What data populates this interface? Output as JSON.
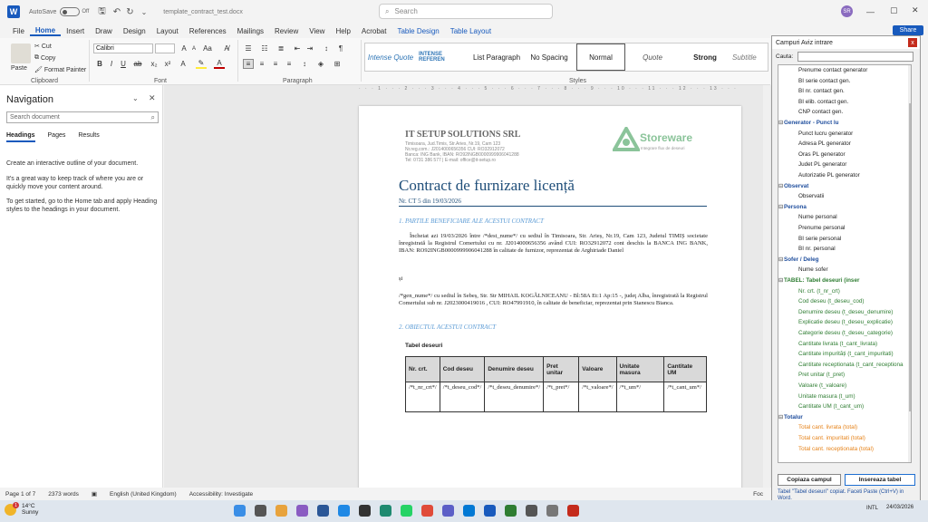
{
  "titlebar": {
    "autosave_label": "AutoSave",
    "autosave_state": "Off",
    "filename": "template_contract_test.docx",
    "search_placeholder": "Search",
    "avatar_initials": "SR",
    "share_label": "Share"
  },
  "menu": [
    "File",
    "Home",
    "Insert",
    "Draw",
    "Design",
    "Layout",
    "References",
    "Mailings",
    "Review",
    "View",
    "Help",
    "Acrobat",
    "Table Design",
    "Table Layout"
  ],
  "ribbon": {
    "clipboard": {
      "paste": "Paste",
      "cut": "Cut",
      "copy": "Copy",
      "format_painter": "Format Painter",
      "group": "Clipboard"
    },
    "font": {
      "name": "Calibri",
      "size": "",
      "group": "Font"
    },
    "paragraph": {
      "group": "Paragraph"
    },
    "styles": {
      "items": [
        "Intense Quote",
        "INTENSE REFEREN",
        "List Paragraph",
        "No Spacing",
        "Normal",
        "Quote",
        "Strong",
        "Subtitle"
      ],
      "group": "Styles"
    }
  },
  "navigation": {
    "title": "Navigation",
    "search_placeholder": "Search document",
    "tabs": [
      "Headings",
      "Pages",
      "Results"
    ],
    "p1": "Create an interactive outline of your document.",
    "p2": "It's a great way to keep track of where you are or quickly move your content around.",
    "p3": "To get started, go to the Home tab and apply Heading styles to the headings in your document."
  },
  "document": {
    "company": "IT SETUP SOLUTIONS SRL",
    "company_lines": [
      "Timisoara, Jud.Timis, Str.Aries, Nr.19, Cam 123",
      "Nr.reg.com.: J2014000656356  CUI: RO32912072",
      "Banca: ING Bank,  IBAN: RO92INGB0000999906041288",
      "Tel: 0731 386 577 | E-mail: office@it-setup.ro"
    ],
    "logo_name": "Storeware",
    "logo_tagline": "Integrare flux de deseuri",
    "title": "Contract de furnizare licență",
    "number": "Nr.  CT 5  din 19/03/2026",
    "section1": "1. PARTILE BENEFICIARE ALE ACESTUI CONTRACT",
    "para1": "Încheiat azi 19/03/2026 între /*dest_nume*/ cu sediul în Timisoara, Str. Arieș, Nr.19, Cam 123, Judetul TIMIȘ societate înregistrată la Registrul Comertului cu nr. J2014000656356 având CUI: RO32912072 cont deschis la BANCA ING BANK, IBAN: RO92INGB0000999906041288 în calitate de furnizor, reprezentat de Arghiriade Daniel",
    "si": "și",
    "para2": "/*gen_nume*/ cu sediul în Sebeș, Str. Str MIHAIL KOGĂLNICEANU - Bl:58A Et:1 Ap:15 -, judeţ Alba, înregistrată la Registrul Comertului sub nr. J2023000419016 , CUI: RO47991910, în calitate de beneficiar, reprezentat prin Stanescu Bianca.",
    "section2": "2. OBIECTUL ACESTUI CONTRACT",
    "table_label": "Tabel deseuri",
    "table_headers": [
      "Nr. crt.",
      "Cod deseu",
      "Denumire deseu",
      "Pret unitar",
      "Valoare",
      "Unitate masura",
      "Cantitate UM"
    ],
    "table_row": [
      "/*t_nr_crt*/",
      "/*t_deseu_cod*/",
      "/*t_deseu_denumire*/",
      "/*t_pret*/",
      "/*t_valoare*/",
      "/*t_um*/",
      "/*t_cant_um*/"
    ]
  },
  "sidepanel": {
    "title": "Campuri Aviz intrare",
    "search_label": "Cauta:",
    "tree": [
      {
        "text": "Prenume contact generator",
        "kind": "item"
      },
      {
        "text": "BI serie contact gen.",
        "kind": "item"
      },
      {
        "text": "BI nr. contact gen.",
        "kind": "item"
      },
      {
        "text": "BI elib. contact gen.",
        "kind": "item"
      },
      {
        "text": "CNP contact gen.",
        "kind": "item"
      },
      {
        "text": "Generator - Punct lu",
        "kind": "grp"
      },
      {
        "text": "Punct lucru generator",
        "kind": "item"
      },
      {
        "text": "Adresa PL generator",
        "kind": "item"
      },
      {
        "text": "Oras PL generator",
        "kind": "item"
      },
      {
        "text": "Judet PL generator",
        "kind": "item"
      },
      {
        "text": "Autorizatie PL generator",
        "kind": "item"
      },
      {
        "text": "Observat",
        "kind": "grp"
      },
      {
        "text": "Observatii",
        "kind": "item"
      },
      {
        "text": "Persona",
        "kind": "grp"
      },
      {
        "text": "Nume personal",
        "kind": "item"
      },
      {
        "text": "Prenume personal",
        "kind": "item"
      },
      {
        "text": "BI serie personal",
        "kind": "item"
      },
      {
        "text": "BI nr. personal",
        "kind": "item"
      },
      {
        "text": "Sofer / Deleg",
        "kind": "grp"
      },
      {
        "text": "Nume sofer",
        "kind": "item"
      },
      {
        "text": "TABEL: Tabel deseuri (inser",
        "kind": "grp-green"
      },
      {
        "text": "Nr. crt.  (t_nr_crt)",
        "kind": "green"
      },
      {
        "text": "Cod deseu  (t_deseu_cod)",
        "kind": "green"
      },
      {
        "text": "Denumire deseu  (t_deseu_denumire)",
        "kind": "green"
      },
      {
        "text": "Explicatie deseu  (t_deseu_explicatie)",
        "kind": "green"
      },
      {
        "text": "Categorie deseu  (t_deseu_categorie)",
        "kind": "green"
      },
      {
        "text": "Cantitate livrata  (t_cant_livrata)",
        "kind": "green"
      },
      {
        "text": "Cantitate impurități  (t_cant_impuritati)",
        "kind": "green"
      },
      {
        "text": "Cantitate receptionata  (t_cant_receptiona",
        "kind": "green"
      },
      {
        "text": "Pret unitar  (t_pret)",
        "kind": "green"
      },
      {
        "text": "Valoare  (t_valoare)",
        "kind": "green"
      },
      {
        "text": "Unitate masura  (t_um)",
        "kind": "green"
      },
      {
        "text": "Cantitate UM  (t_cant_um)",
        "kind": "green"
      },
      {
        "text": "Totalur",
        "kind": "grp"
      },
      {
        "text": "Total cant. livrata (total)",
        "kind": "gold"
      },
      {
        "text": "Total cant. impuritati (total)",
        "kind": "gold"
      },
      {
        "text": "Total cant. receptionata (total)",
        "kind": "gold"
      }
    ],
    "copy_button": "Copiaza campul",
    "insert_button": "Insereaza tabel",
    "message": "Tabel \"Tabel deseuri\" copiat. Faceti Paste (Ctrl+V) in Word."
  },
  "statusbar": {
    "page": "Page 1 of 7",
    "words": "2373 words",
    "language": "English (United Kingdom)",
    "accessibility": "Accessibility: Investigate",
    "focus": "Foc"
  },
  "taskbar": {
    "temp": "14°C",
    "weather": "Sunny",
    "notif_count": "1",
    "lang": "INTL",
    "date": "24/03/2026"
  }
}
